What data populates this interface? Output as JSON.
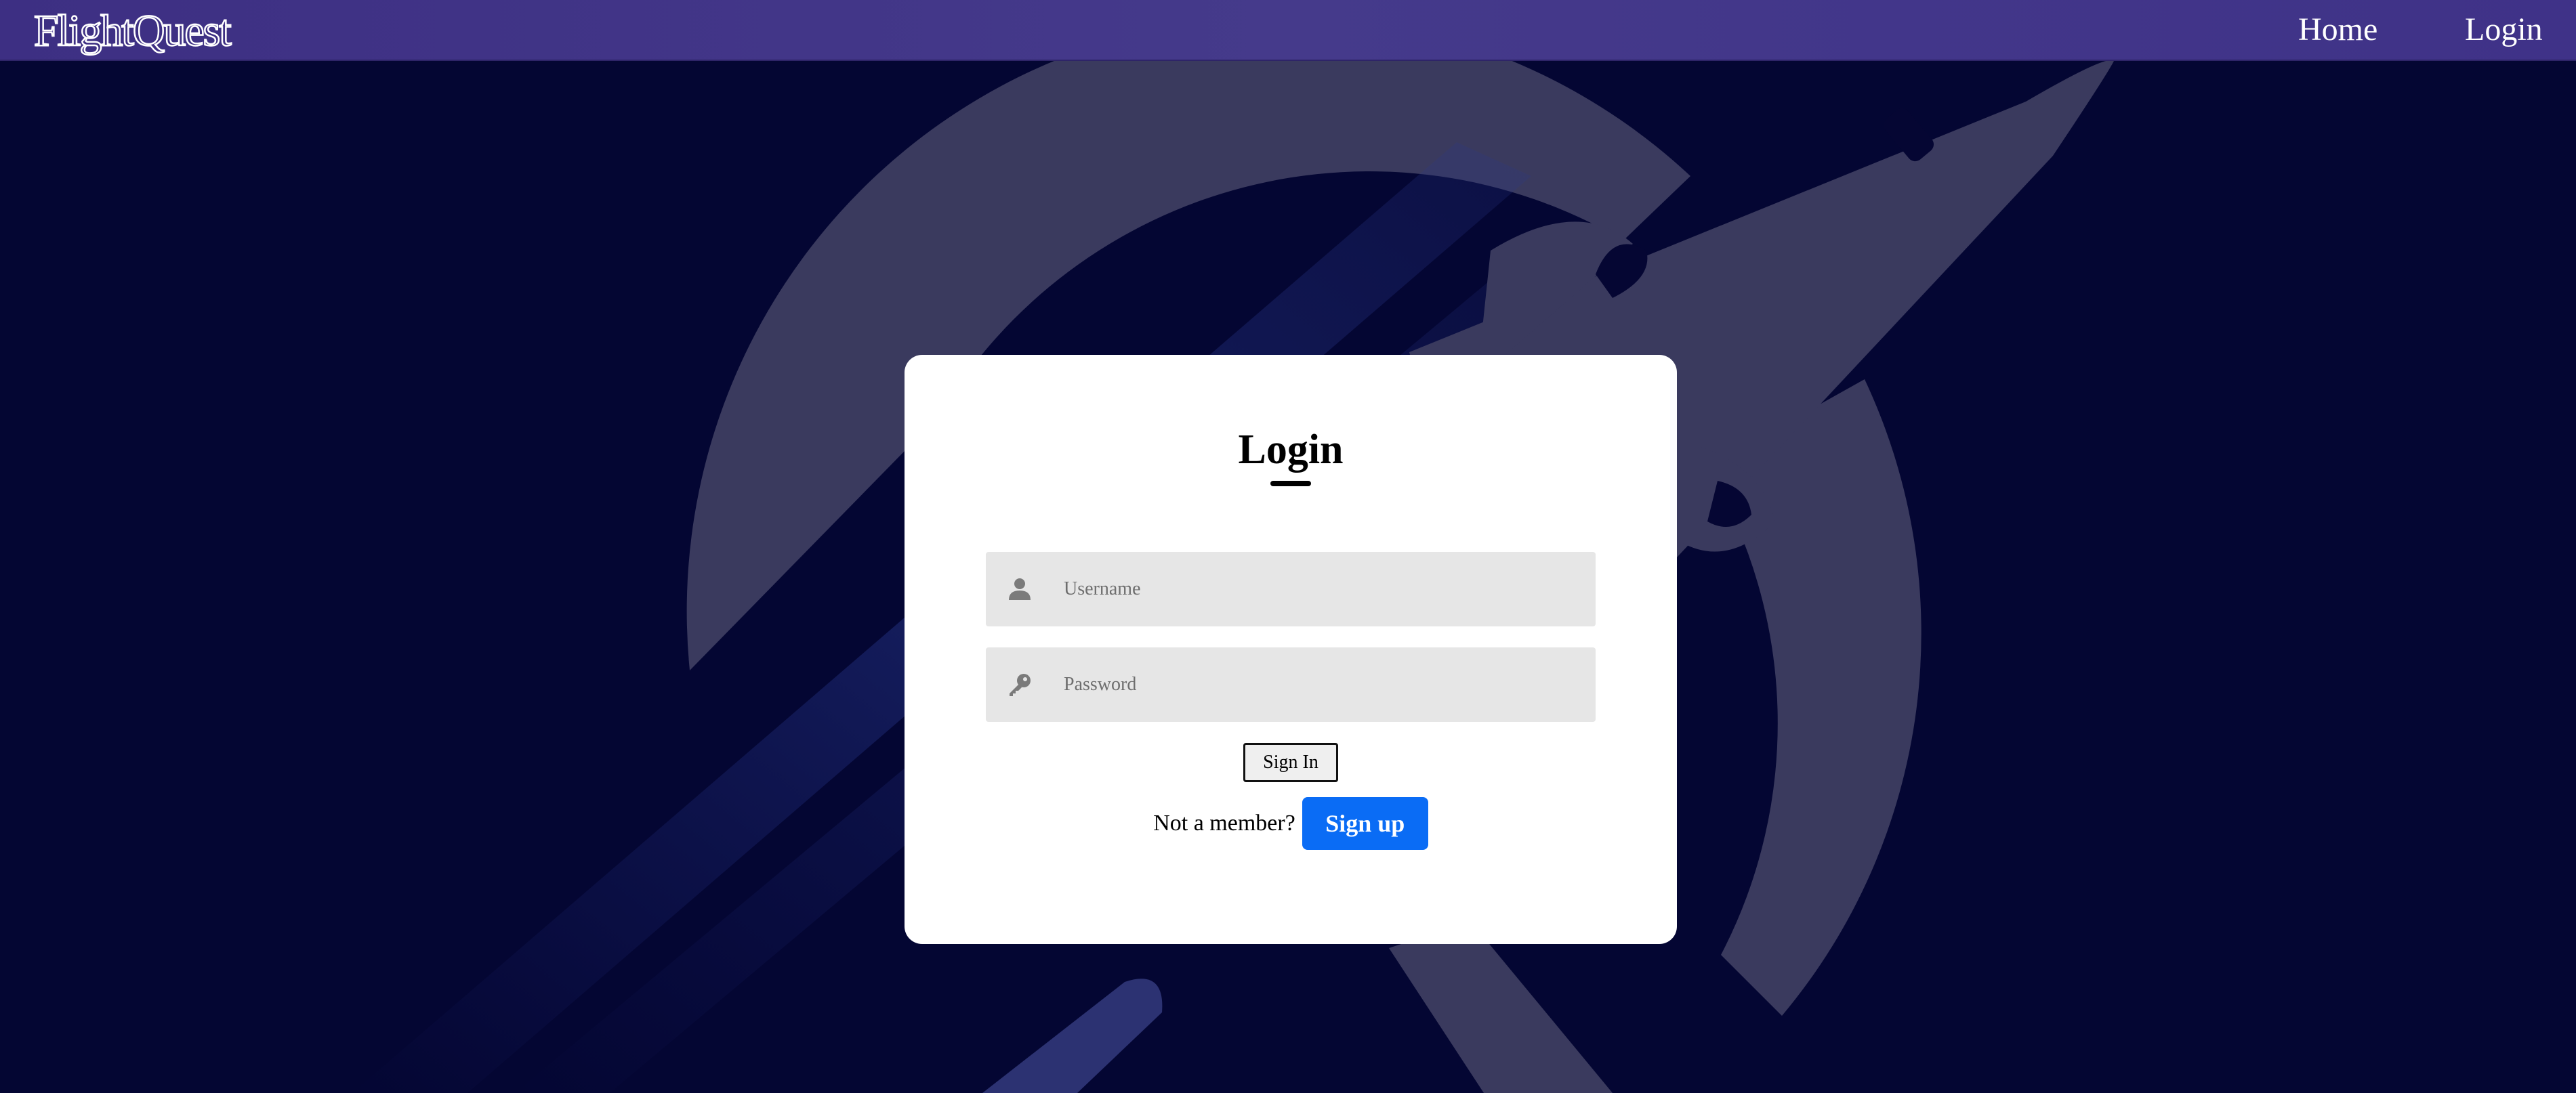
{
  "header": {
    "brand": "FlightQuest",
    "nav": [
      {
        "label": "Home"
      },
      {
        "label": "Login"
      }
    ]
  },
  "login": {
    "title": "Login",
    "username_placeholder": "Username",
    "username_value": "",
    "password_placeholder": "Password",
    "password_value": "",
    "signin_label": "Sign In",
    "member_prompt": "Not a member?",
    "signup_label": "Sign up"
  },
  "icons": {
    "username": "user-icon",
    "password": "key-icon",
    "background": "airplane-globe-icon"
  },
  "colors": {
    "background": "#040633",
    "header": "#3f3288",
    "signup_button": "#0a6cf5",
    "card": "#ffffff",
    "field": "#e6e6e6"
  }
}
